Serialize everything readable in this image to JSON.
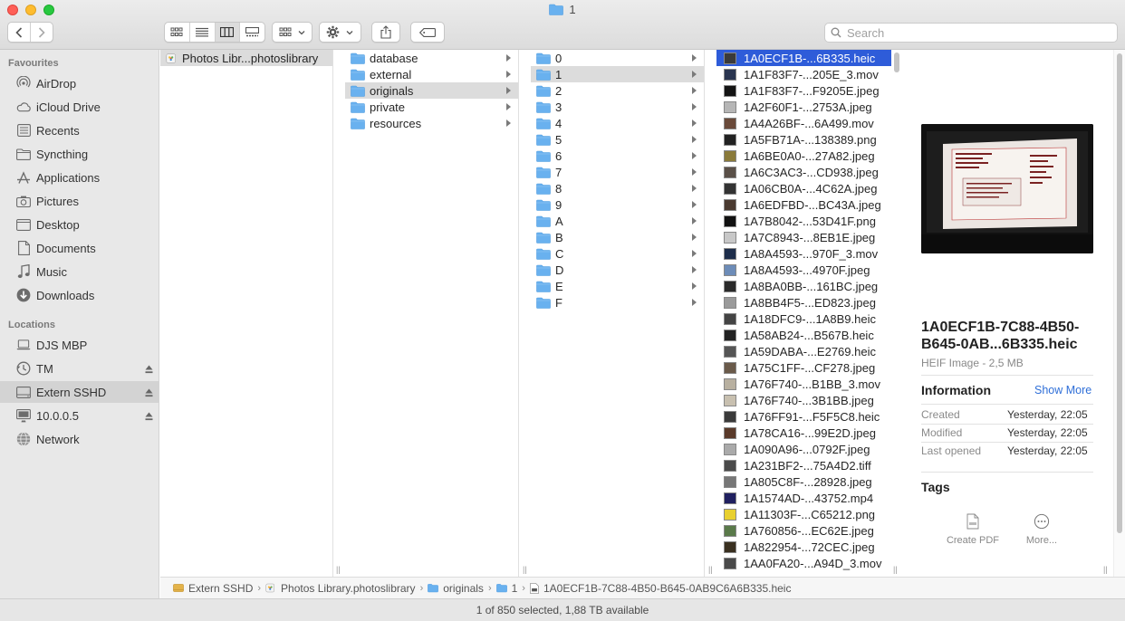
{
  "window": {
    "title": "1"
  },
  "toolbar": {
    "search_placeholder": "Search"
  },
  "sidebar": {
    "favourites_header": "Favourites",
    "favourites": [
      {
        "label": "AirDrop",
        "icon": "airdrop-icon"
      },
      {
        "label": "iCloud Drive",
        "icon": "cloud-icon"
      },
      {
        "label": "Recents",
        "icon": "recents-icon"
      },
      {
        "label": "Syncthing",
        "icon": "folder-icon"
      },
      {
        "label": "Applications",
        "icon": "applications-icon"
      },
      {
        "label": "Pictures",
        "icon": "camera-icon"
      },
      {
        "label": "Desktop",
        "icon": "desktop-icon"
      },
      {
        "label": "Documents",
        "icon": "document-icon"
      },
      {
        "label": "Music",
        "icon": "music-icon"
      },
      {
        "label": "Downloads",
        "icon": "download-icon"
      }
    ],
    "locations_header": "Locations",
    "locations": [
      {
        "label": "DJS MBP",
        "icon": "laptop-icon",
        "eject": false,
        "selected": false
      },
      {
        "label": "TM",
        "icon": "time-machine-icon",
        "eject": true,
        "selected": false
      },
      {
        "label": "Extern SSHD",
        "icon": "drive-icon",
        "eject": true,
        "selected": true
      },
      {
        "label": "10.0.0.5",
        "icon": "display-icon",
        "eject": true,
        "selected": false
      },
      {
        "label": "Network",
        "icon": "network-icon",
        "eject": false,
        "selected": false
      }
    ]
  },
  "columns": {
    "col1": [
      {
        "label": "Photos Libr...photoslibrary"
      }
    ],
    "col2": [
      {
        "label": "database"
      },
      {
        "label": "external"
      },
      {
        "label": "originals",
        "selected": true
      },
      {
        "label": "private"
      },
      {
        "label": "resources"
      }
    ],
    "col3": [
      {
        "label": "0"
      },
      {
        "label": "1",
        "selected": true
      },
      {
        "label": "2"
      },
      {
        "label": "3"
      },
      {
        "label": "4"
      },
      {
        "label": "5"
      },
      {
        "label": "6"
      },
      {
        "label": "7"
      },
      {
        "label": "8"
      },
      {
        "label": "9"
      },
      {
        "label": "A"
      },
      {
        "label": "B"
      },
      {
        "label": "C"
      },
      {
        "label": "D"
      },
      {
        "label": "E"
      },
      {
        "label": "F"
      }
    ],
    "col4": [
      {
        "label": "1A0ECF1B-...6B335.heic",
        "selected": true
      },
      {
        "label": "1A1F83F7-...205E_3.mov"
      },
      {
        "label": "1A1F83F7-...F9205E.jpeg"
      },
      {
        "label": "1A2F60F1-...2753A.jpeg"
      },
      {
        "label": "1A4A26BF-...6A499.mov"
      },
      {
        "label": "1A5FB71A-...138389.png"
      },
      {
        "label": "1A6BE0A0-...27A82.jpeg"
      },
      {
        "label": "1A6C3AC3-...CD938.jpeg"
      },
      {
        "label": "1A06CB0A-...4C62A.jpeg"
      },
      {
        "label": "1A6EDFBD-...BC43A.jpeg"
      },
      {
        "label": "1A7B8042-...53D41F.png"
      },
      {
        "label": "1A7C8943-...8EB1E.jpeg"
      },
      {
        "label": "1A8A4593-...970F_3.mov"
      },
      {
        "label": "1A8A4593-...4970F.jpeg"
      },
      {
        "label": "1A8BA0BB-...161BC.jpeg"
      },
      {
        "label": "1A8BB4F5-...ED823.jpeg"
      },
      {
        "label": "1A18DFC9-...1A8B9.heic"
      },
      {
        "label": "1A58AB24-...B567B.heic"
      },
      {
        "label": "1A59DABA-...E2769.heic"
      },
      {
        "label": "1A75C1FF-...CF278.jpeg"
      },
      {
        "label": "1A76F740-...B1BB_3.mov"
      },
      {
        "label": "1A76F740-...3B1BB.jpeg"
      },
      {
        "label": "1A76FF91-...F5F5C8.heic"
      },
      {
        "label": "1A78CA16-...99E2D.jpeg"
      },
      {
        "label": "1A090A96-...0792F.jpeg"
      },
      {
        "label": "1A231BF2-...75A4D2.tiff"
      },
      {
        "label": "1A805C8F-...28928.jpeg"
      },
      {
        "label": "1A1574AD-...43752.mp4"
      },
      {
        "label": "1A11303F-...C65212.png"
      },
      {
        "label": "1A760856-...EC62E.jpeg"
      },
      {
        "label": "1A822954-...72CEC.jpeg"
      },
      {
        "label": "1AA0FA20-...A94D_3.mov"
      }
    ]
  },
  "preview": {
    "name": "1A0ECF1B-7C88-4B50-B645-0AB...6B335.heic",
    "kind": "HEIF Image - 2,5 MB",
    "info_header": "Information",
    "show_more": "Show More",
    "info": [
      {
        "label": "Created",
        "value": "Yesterday, 22:05"
      },
      {
        "label": "Modified",
        "value": "Yesterday, 22:05"
      },
      {
        "label": "Last opened",
        "value": "Yesterday, 22:05"
      }
    ],
    "tags_header": "Tags",
    "actions": [
      {
        "label": "Create PDF",
        "icon": "pdf-icon"
      },
      {
        "label": "More...",
        "icon": "more-icon"
      }
    ]
  },
  "pathbar": [
    {
      "label": "Extern SSHD",
      "icon": "drive-icon"
    },
    {
      "label": "Photos Library.photoslibrary",
      "icon": "photos-library-icon"
    },
    {
      "label": "originals",
      "icon": "folder-icon"
    },
    {
      "label": "1",
      "icon": "folder-icon"
    },
    {
      "label": "1A0ECF1B-7C88-4B50-B645-0AB9C6A6B335.heic",
      "icon": "file-icon"
    }
  ],
  "status": {
    "text": "1 of 850 selected, 1,88 TB available"
  },
  "colors": {
    "selection_blue": "#2e5cd9",
    "folder_blue": "#69b1ef",
    "link_blue": "#2f6fd8"
  }
}
